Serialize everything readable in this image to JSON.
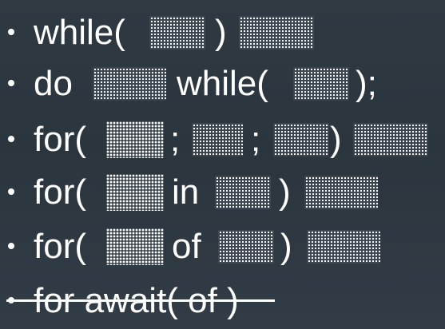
{
  "slide": {
    "lines": [
      {
        "prefix": "while(",
        "middle": ")",
        "suffix": ""
      },
      {
        "prefix": "do",
        "middle": "while(",
        "suffix": ");"
      },
      {
        "prefix": "for(",
        "sep1": ";",
        "sep2": ";",
        "close": ")"
      },
      {
        "prefix": "for(",
        "middle": "in",
        "close": ")"
      },
      {
        "prefix": "for(",
        "middle": "of",
        "close": ")"
      },
      {
        "text": "for await( of )",
        "strikethrough": true
      }
    ]
  },
  "colors": {
    "background": "#2e3942",
    "text": "#ffffff",
    "placeholder": "#ffffff"
  }
}
